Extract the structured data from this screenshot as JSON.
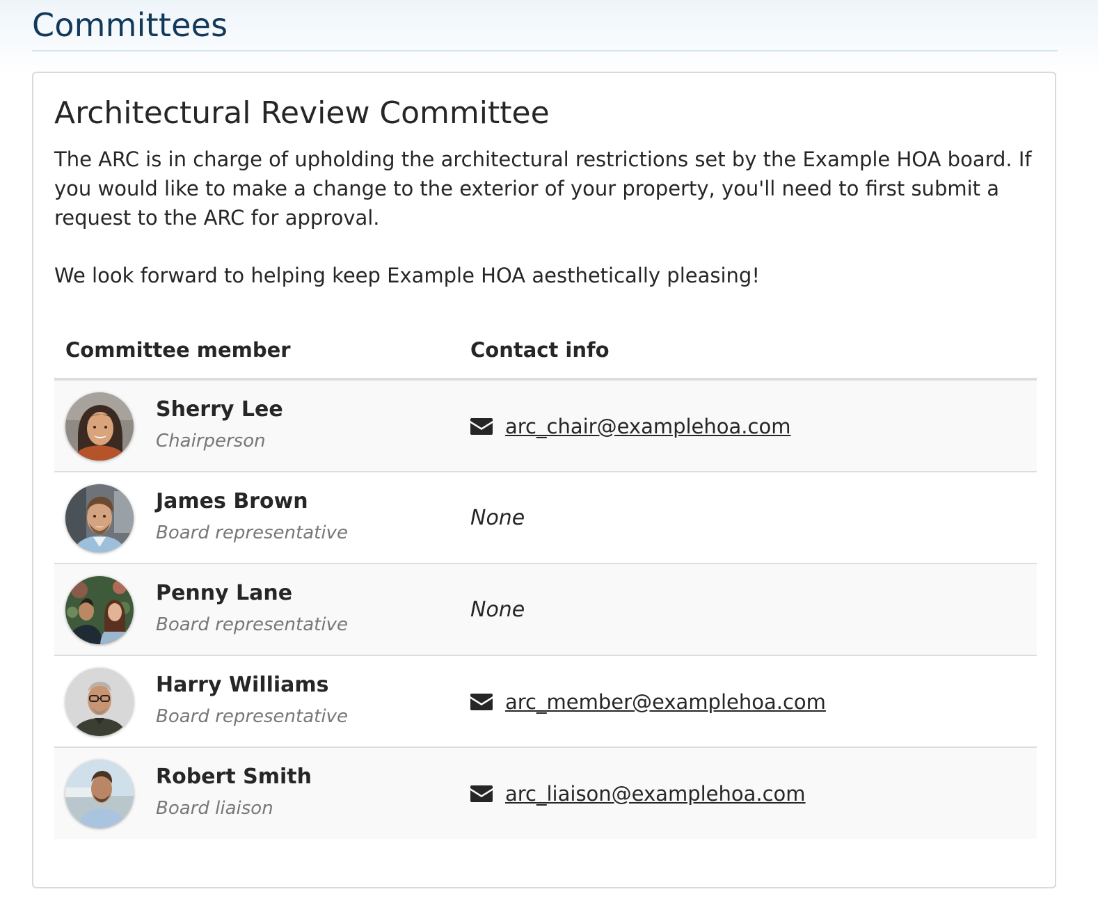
{
  "page": {
    "title": "Committees"
  },
  "committee": {
    "title": "Architectural Review Committee",
    "description_1": "The ARC is in charge of upholding the architectural restrictions set by the Example HOA board. If you would like to make a change to the exterior of your property, you'll need to first submit a request to the ARC for approval.",
    "description_2": "We look forward to helping keep Example HOA aesthetically pleasing!",
    "table": {
      "headers": {
        "member": "Committee member",
        "contact": "Contact info"
      },
      "rows": [
        {
          "name": "Sherry Lee",
          "role": "Chairperson",
          "email": "arc_chair@examplehoa.com",
          "contact_none": ""
        },
        {
          "name": "James Brown",
          "role": "Board representative",
          "email": "",
          "contact_none": "None"
        },
        {
          "name": "Penny Lane",
          "role": "Board representative",
          "email": "",
          "contact_none": "None"
        },
        {
          "name": "Harry Williams",
          "role": "Board representative",
          "email": "arc_member@examplehoa.com",
          "contact_none": ""
        },
        {
          "name": "Robert Smith",
          "role": "Board liaison",
          "email": "arc_liaison@examplehoa.com",
          "contact_none": ""
        }
      ]
    }
  },
  "colors": {
    "page_title": "#12395a",
    "text": "#262626",
    "muted": "#777777",
    "striped_row": "#f9f9f9",
    "divider": "#dddddd"
  },
  "icons": {
    "email": "envelope-icon"
  }
}
